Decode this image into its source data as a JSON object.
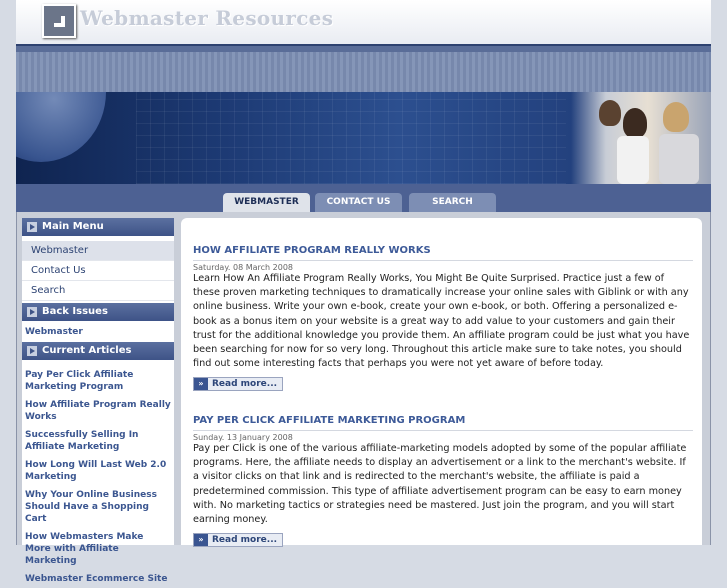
{
  "header": {
    "site_title": "Webmaster Resources"
  },
  "nav": {
    "tabs": [
      "WEBMASTER",
      "CONTACT US",
      "SEARCH"
    ]
  },
  "sidebar": {
    "main_menu_title": "Main Menu",
    "main_menu_items": [
      "Webmaster",
      "Contact Us",
      "Search"
    ],
    "back_issues_title": "Back Issues",
    "back_issues_items": [
      "Webmaster"
    ],
    "current_articles_title": "Current Articles",
    "current_articles": [
      "Pay Per Click Affiliate Marketing Program",
      "How Affiliate Program Really Works",
      "Successfully Selling In Affiliate Marketing",
      "How Long Will Last Web 2.0 Marketing",
      "Why Your Online Business Should Have a Shopping Cart",
      "How Webmasters Make More with Affiliate Marketing",
      "Webmaster Ecommerce Site"
    ]
  },
  "articles": [
    {
      "title": "HOW AFFILIATE PROGRAM REALLY WORKS",
      "date": "Saturday. 08 March 2008",
      "body": "Learn How An Affiliate Program Really Works, You Might Be Quite Surprised. Practice just a few of these proven marketing techniques to dramatically increase your online sales with Giblink or with any online business. Write your own e-book, create your own e-book, or both. Offering a personalized e-book as a bonus item on your website is a great way to add value to your customers and gain their trust for the additional knowledge you provide them. An affiliate program could be just what you have been searching for now for so very long. Throughout this article make sure to take notes, you should find out some interesting facts that perhaps you were not yet aware of before today.",
      "read_more": "Read more..."
    },
    {
      "title": "PAY PER CLICK AFFILIATE MARKETING PROGRAM",
      "date": "Sunday. 13 January 2008",
      "body": "Pay per Click is one of the various affiliate-marketing models adopted by some of the popular affiliate programs. Here, the affiliate needs to display an advertisement or a link to the merchant's website. If a visitor clicks on that link and is redirected to the merchant's website, the affiliate is paid a predetermined commission. This type of affiliate advertisement program can be easy to earn money with. No marketing tactics or strategies need be mastered. Just join the program, and you will start earning money.",
      "read_more": "Read more..."
    }
  ]
}
